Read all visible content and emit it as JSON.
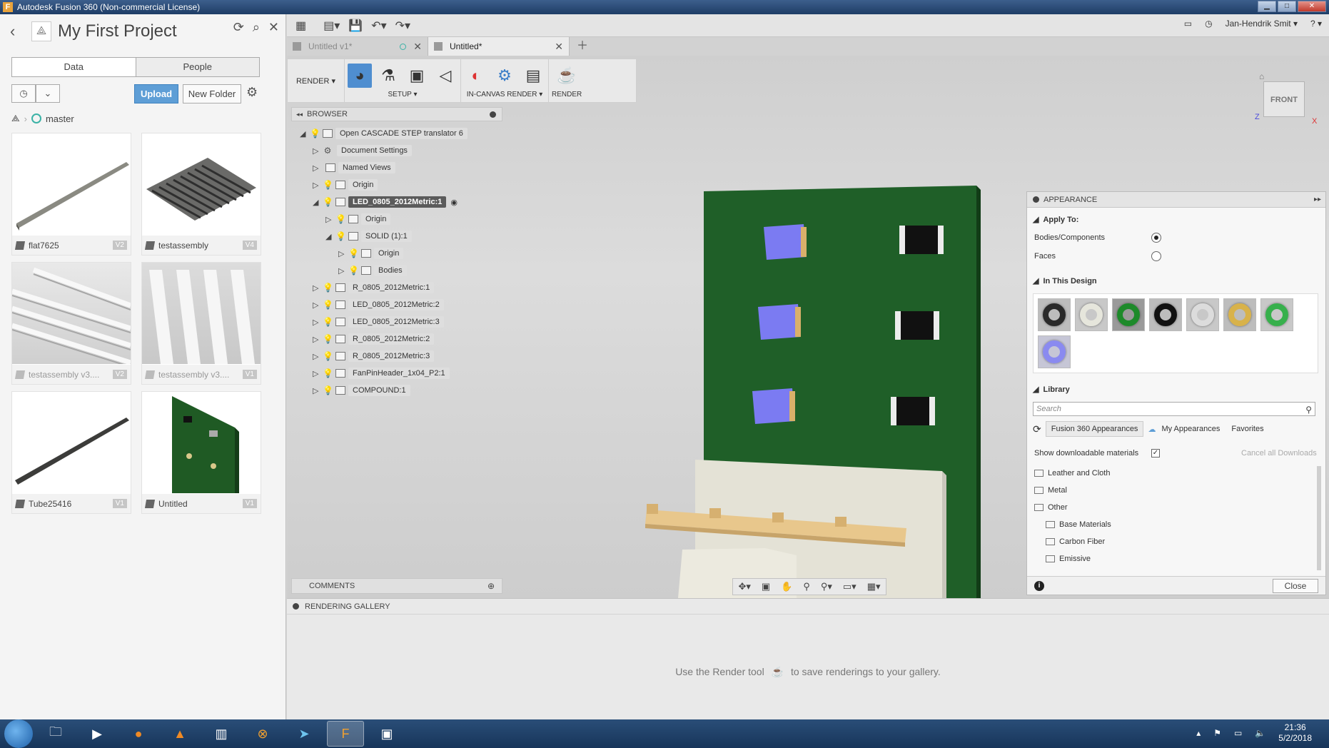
{
  "window": {
    "title": "Autodesk Fusion 360 (Non-commercial License)"
  },
  "data_panel": {
    "title": "My First Project",
    "tabs": [
      {
        "label": "Data"
      },
      {
        "label": "People"
      }
    ],
    "upload_label": "Upload",
    "new_folder_label": "New Folder",
    "branch": "master",
    "files": [
      {
        "name": "flat7625",
        "version": "V2"
      },
      {
        "name": "testassembly",
        "version": "V4"
      },
      {
        "name": "testassembly v3....",
        "version": "V2"
      },
      {
        "name": "testassembly v3....",
        "version": "V1"
      },
      {
        "name": "Tube25416",
        "version": "V1"
      },
      {
        "name": "Untitled",
        "version": "V1"
      }
    ]
  },
  "topbar": {
    "user": "Jan-Hendrik Smit ▾",
    "help": "? ▾"
  },
  "doc_tabs": [
    {
      "label": "Untitled v1*"
    },
    {
      "label": "Untitled*"
    }
  ],
  "ribbon": {
    "workspace": "RENDER ▾",
    "groups": [
      {
        "label": "SETUP ▾"
      },
      {
        "label": "IN-CANVAS RENDER ▾"
      },
      {
        "label": "RENDER"
      }
    ]
  },
  "browser": {
    "title": "BROWSER",
    "nodes": [
      {
        "label": "Open CASCADE STEP translator 6"
      },
      {
        "label": "Document Settings"
      },
      {
        "label": "Named Views"
      },
      {
        "label": "Origin"
      },
      {
        "label": "LED_0805_2012Metric:1"
      },
      {
        "label": "Origin"
      },
      {
        "label": "SOLID (1):1"
      },
      {
        "label": "Origin"
      },
      {
        "label": "Bodies"
      },
      {
        "label": "R_0805_2012Metric:1"
      },
      {
        "label": "LED_0805_2012Metric:2"
      },
      {
        "label": "LED_0805_2012Metric:3"
      },
      {
        "label": "R_0805_2012Metric:2"
      },
      {
        "label": "R_0805_2012Metric:3"
      },
      {
        "label": "FanPinHeader_1x04_P2:1"
      },
      {
        "label": "COMPOUND:1"
      }
    ]
  },
  "comments": {
    "title": "COMMENTS"
  },
  "viewcube": {
    "face": "FRONT",
    "axis_x": "X",
    "axis_z": "Z"
  },
  "appearance": {
    "title": "APPEARANCE",
    "apply_to": "Apply To:",
    "bodies_label": "Bodies/Components",
    "faces_label": "Faces",
    "in_design": "In This Design",
    "swatch_colors": [
      "#2a2a2a",
      "#e6e6dc",
      "#1d8a2a",
      "#111111",
      "#dcdcdc",
      "#d8b24a",
      "#37b04c",
      "#8a8af0"
    ],
    "library": "Library",
    "search_placeholder": "Search",
    "lib_tabs": [
      {
        "label": "Fusion 360 Appearances"
      },
      {
        "label": "My Appearances"
      },
      {
        "label": "Favorites"
      }
    ],
    "show_downloadable": "Show downloadable materials",
    "cancel_downloads": "Cancel all Downloads",
    "folders": [
      {
        "label": "Leather and Cloth"
      },
      {
        "label": "Metal"
      },
      {
        "label": "Other"
      },
      {
        "label": "Base Materials"
      },
      {
        "label": "Carbon Fiber"
      },
      {
        "label": "Emissive"
      }
    ],
    "close_label": "Close"
  },
  "gallery": {
    "title": "RENDERING GALLERY",
    "message_before": "Use the Render tool",
    "message_after": "to save renderings to your gallery."
  },
  "taskbar": {
    "time": "21:36",
    "date": "5/2/2018"
  },
  "colors": {
    "pcb_green": "#1f5f28",
    "led_blue": "#7b7bf2",
    "accent_blue": "#5e9ed6"
  }
}
